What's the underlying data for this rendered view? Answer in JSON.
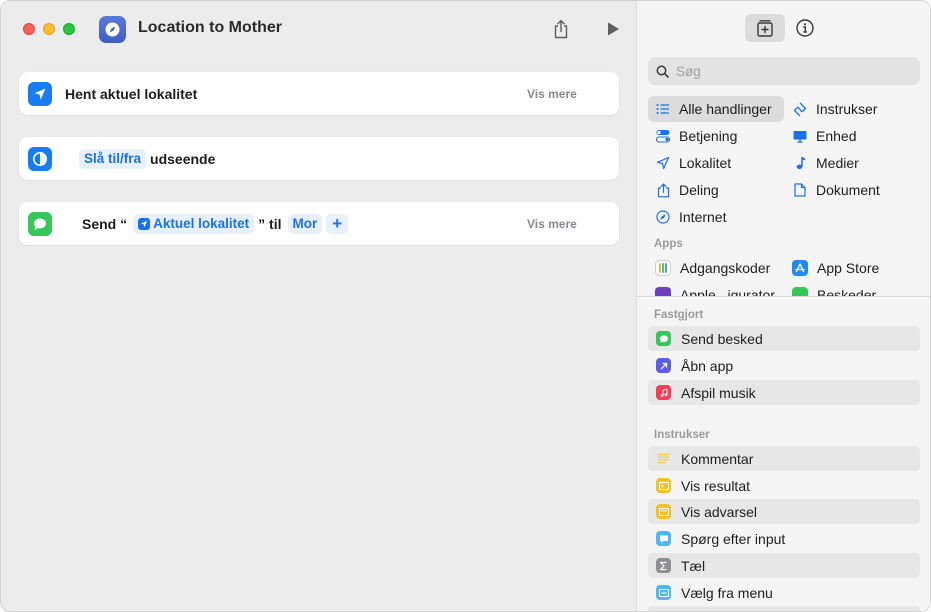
{
  "window": {
    "title": "Location to Mother"
  },
  "editor": {
    "actions": [
      {
        "label": "Hent aktuel lokalitet",
        "more": "Vis mere"
      },
      {
        "pill": "Slå til/fra",
        "label": "udseende"
      },
      {
        "prefix": "Send “",
        "variable": "Aktuel lokalitet",
        "middle": "” til",
        "recipient": "Mor",
        "add": "+",
        "more": "Vis mere"
      }
    ]
  },
  "library": {
    "search": {
      "placeholder": "Søg",
      "value": ""
    },
    "categories": [
      {
        "label": "Alle handlinger",
        "icon": "list-icon",
        "selected": true
      },
      {
        "label": "Instrukser",
        "icon": "scripting-icon"
      },
      {
        "label": "Betjening",
        "icon": "toggles-icon"
      },
      {
        "label": "Enhed",
        "icon": "display-icon"
      },
      {
        "label": "Lokalitet",
        "icon": "location-arrow-icon"
      },
      {
        "label": "Medier",
        "icon": "music-note-icon"
      },
      {
        "label": "Deling",
        "icon": "share-icon"
      },
      {
        "label": "Dokument",
        "icon": "document-icon"
      },
      {
        "label": "Internet",
        "icon": "compass-icon"
      }
    ],
    "apps_label": "Apps",
    "apps": [
      {
        "label": "Adgangskoder",
        "icon": "passwords-app-icon"
      },
      {
        "label": "App Store",
        "icon": "app-store-icon"
      },
      {
        "label": "Apple...igurator",
        "icon": "configurator-app-icon"
      },
      {
        "label": "Beskeder",
        "icon": "messages-app-icon"
      }
    ],
    "pinned_label": "Fastgjort",
    "pinned": [
      {
        "label": "Send besked",
        "icon": "messages-icon",
        "color": "#34c759"
      },
      {
        "label": "Åbn app",
        "icon": "open-app-icon",
        "color": "#5e5ce6"
      },
      {
        "label": "Afspil musik",
        "icon": "music-icon",
        "color": "#fa3d55"
      }
    ],
    "scripting_label": "Instrukser",
    "scripting": [
      {
        "label": "Kommentar",
        "icon": "comment-icon",
        "color": "#f5d76e"
      },
      {
        "label": "Vis resultat",
        "icon": "show-result-icon",
        "color": "#f7c026"
      },
      {
        "label": "Vis advarsel",
        "icon": "alert-icon",
        "color": "#f7c026"
      },
      {
        "label": "Spørg efter input",
        "icon": "ask-input-icon",
        "color": "#4fb8f0"
      },
      {
        "label": "Tæl",
        "icon": "sigma-icon",
        "color": "#8e8e93"
      },
      {
        "label": "Vælg fra menu",
        "icon": "menu-icon",
        "color": "#4fb8f0"
      }
    ]
  },
  "colors": {
    "accent": "#1a6ff2",
    "location_blue": "#1a7cf5",
    "messages_green": "#34c759"
  }
}
